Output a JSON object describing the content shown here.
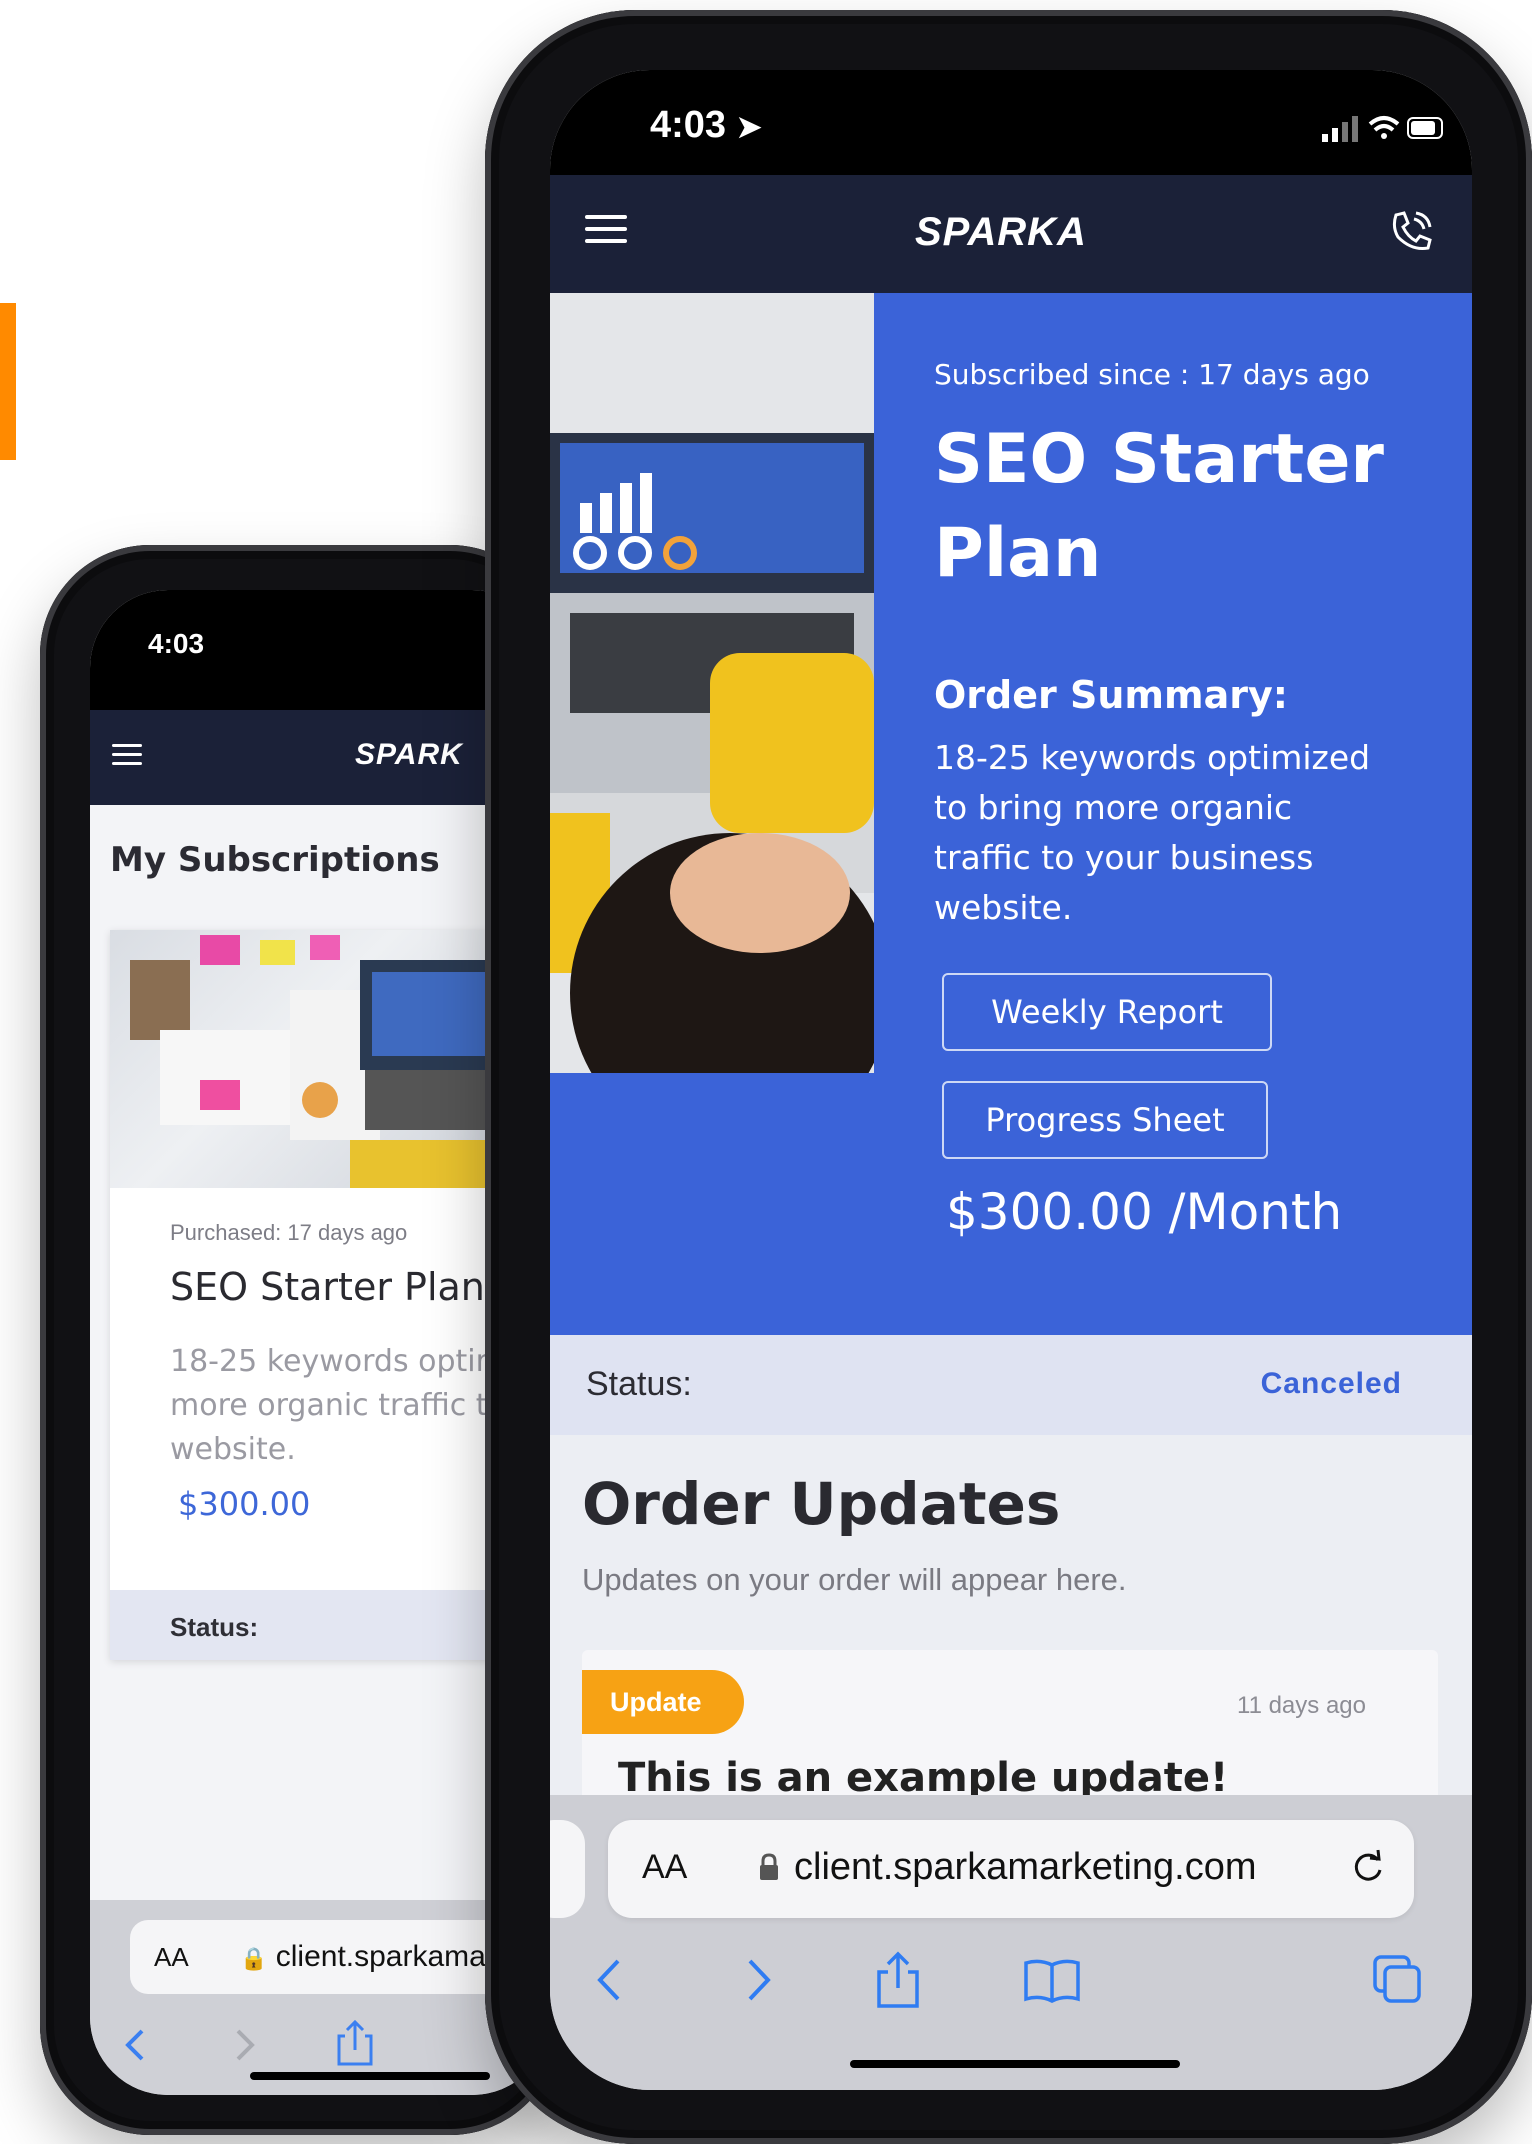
{
  "back_phone": {
    "time": "4:03",
    "logo": "SPARK",
    "page_title": "My Subscriptions",
    "card": {
      "purchased": "Purchased: 17 days ago",
      "plan_name": "SEO Starter Plan",
      "description": "18-25 keywords optim more organic traffic to website.",
      "price": "$300.00",
      "status_label": "Status:"
    },
    "url": "client.sparkamar",
    "url_aa": "AA"
  },
  "front_phone": {
    "time": "4:03",
    "logo": "SPARKA",
    "subscribed_since": "Subscribed since : 17 days ago",
    "plan_name": "SEO Starter Plan",
    "order_summary_label": "Order Summary:",
    "order_summary_text": "18-25 keywords optimized to bring more organic traffic to your business website.",
    "buttons": {
      "weekly_report": "Weekly Report",
      "progress_sheet": "Progress Sheet"
    },
    "price": "$300.00 /Month",
    "status_label": "Status:",
    "status_value": "Canceled",
    "updates_title": "Order Updates",
    "updates_subtitle": "Updates on your order will appear here.",
    "update": {
      "badge": "Update",
      "time": "11 days ago",
      "title": "This is an example update!"
    },
    "url_aa": "AA",
    "url": "client.sparkamarketing.com"
  },
  "colors": {
    "nav": "#1b2138",
    "hero": "#3b63d8",
    "badge": "#f7a214",
    "accent_bar": "#ff8a00",
    "status_canceled": "#3b63d8"
  }
}
